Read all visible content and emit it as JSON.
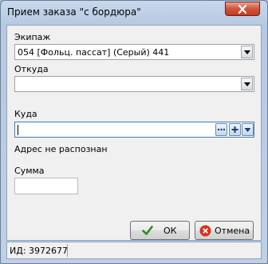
{
  "window": {
    "title": "Прием заказа \"с бордюра\""
  },
  "crew": {
    "label": "Экипаж",
    "value": "054 [Фольц. пассат] (Серый) 441"
  },
  "from": {
    "label": "Откуда",
    "value": ""
  },
  "to": {
    "label": "Куда",
    "value": "",
    "status_text": "Адрес не распознан"
  },
  "sum": {
    "label": "Сумма",
    "value": ""
  },
  "buttons": {
    "ok_label": "ОК",
    "cancel_label": "Отмена"
  },
  "statusbar": {
    "id_text": "ИД: 3972677"
  },
  "icons": {
    "close": "close-icon",
    "ok": "check-icon",
    "cancel": "cancel-circle-icon",
    "ellipsis": "ellipsis-icon",
    "plus": "plus-icon",
    "dropdown": "chevron-down-icon"
  },
  "colors": {
    "title_bar": "#c8d8ec",
    "close_button": "#c23b22",
    "ok_check": "#2e8b1f",
    "cancel_icon": "#d8321e",
    "focus_border": "#3c7fb1"
  }
}
